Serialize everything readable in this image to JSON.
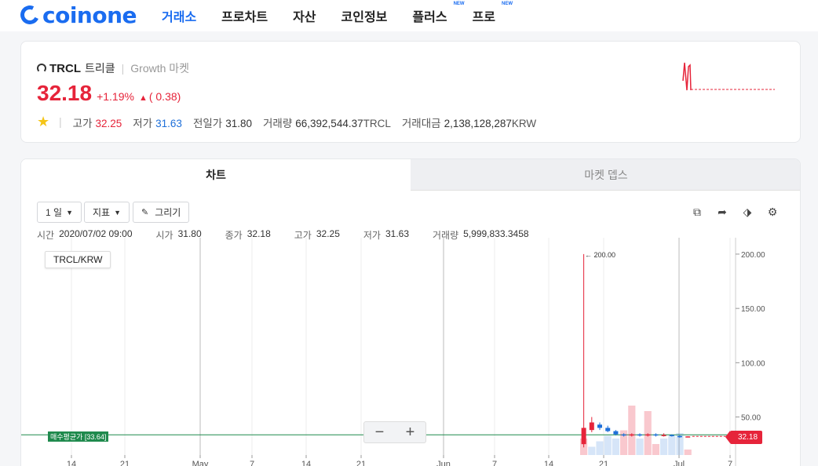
{
  "header": {
    "logo_text": "coinone",
    "nav": [
      {
        "label": "거래소",
        "active": true,
        "badge": ""
      },
      {
        "label": "프로차트",
        "active": false,
        "badge": ""
      },
      {
        "label": "자산",
        "active": false,
        "badge": ""
      },
      {
        "label": "코인정보",
        "active": false,
        "badge": ""
      },
      {
        "label": "플러스",
        "active": false,
        "badge": "NEW"
      },
      {
        "label": "프로",
        "active": false,
        "badge": "NEW"
      }
    ]
  },
  "summary": {
    "symbol": "TRCL",
    "name_kr": "트리클",
    "market": "Growth 마켓",
    "price": "32.18",
    "change_pct": "+1.19%",
    "change_abs": "( 0.38)",
    "change_arrow": "▲",
    "stats": {
      "high_label": "고가",
      "high": "32.25",
      "low_label": "저가",
      "low": "31.63",
      "prev_label": "전일가",
      "prev": "31.80",
      "vol_label": "거래량",
      "vol": "66,392,544.37",
      "vol_unit": "TRCL",
      "amt_label": "거래대금",
      "amt": "2,138,128,287",
      "amt_unit": "KRW"
    }
  },
  "chart_panel": {
    "tab_chart": "차트",
    "tab_depth": "마켓 뎁스",
    "interval_label": "1 일",
    "indicator_label": "지표",
    "draw_label": "그리기",
    "ohlc": {
      "time_label": "시간",
      "time": "2020/07/02 09:00",
      "open_label": "시가",
      "open": "31.80",
      "close_label": "종가",
      "close": "32.18",
      "high_label": "고가",
      "high": "32.25",
      "low_label": "저가",
      "low": "31.63",
      "vol_label": "거래량",
      "vol": "5,999,833.3458"
    },
    "pair_label": "TRCL/KRW",
    "avg_label": "매수평균가 [33.64]",
    "price_tag": "32.18",
    "max_marker": "← 200.00",
    "zoom_minus": "−",
    "zoom_plus": "+"
  },
  "chart_data": {
    "type": "candlestick",
    "y_ticks": [
      "200.00",
      "150.00",
      "100.00",
      "50.00"
    ],
    "ylim": [
      15,
      205
    ],
    "x_tick_labels": [
      "14",
      "21",
      "May",
      "7",
      "14",
      "21",
      "Jun",
      "7",
      "14",
      "21",
      "Jul",
      "7"
    ],
    "avg_buy_price": 33.64,
    "last_price": 32.18,
    "candles": [
      {
        "open": 25,
        "close": 40,
        "high": 200,
        "low": 22,
        "up": true
      },
      {
        "open": 38,
        "close": 45,
        "high": 50,
        "low": 36,
        "up": true
      },
      {
        "open": 43,
        "close": 40,
        "high": 45,
        "low": 38,
        "up": false
      },
      {
        "open": 40,
        "close": 37,
        "high": 42,
        "low": 36,
        "up": false
      },
      {
        "open": 37,
        "close": 34,
        "high": 38,
        "low": 33,
        "up": false
      },
      {
        "open": 34,
        "close": 33,
        "high": 35,
        "low": 32,
        "up": false
      },
      {
        "open": 33,
        "close": 34,
        "high": 35,
        "low": 32,
        "up": true
      },
      {
        "open": 34,
        "close": 33,
        "high": 35,
        "low": 32,
        "up": false
      },
      {
        "open": 33,
        "close": 34,
        "high": 35,
        "low": 32,
        "up": true
      },
      {
        "open": 34,
        "close": 33,
        "high": 35,
        "low": 32,
        "up": false
      },
      {
        "open": 33,
        "close": 33.5,
        "high": 35,
        "low": 32,
        "up": true
      },
      {
        "open": 33.5,
        "close": 32.5,
        "high": 34,
        "low": 32,
        "up": false
      },
      {
        "open": 32.5,
        "close": 32,
        "high": 33,
        "low": 31,
        "up": false
      },
      {
        "open": 31.8,
        "close": 32.18,
        "high": 32.25,
        "low": 31.63,
        "up": true
      }
    ],
    "volumes": [
      {
        "value": 0.3,
        "up": true
      },
      {
        "value": 0.15,
        "up": false
      },
      {
        "value": 0.25,
        "up": false
      },
      {
        "value": 0.35,
        "up": false
      },
      {
        "value": 0.3,
        "up": false
      },
      {
        "value": 0.45,
        "up": true
      },
      {
        "value": 0.9,
        "up": true
      },
      {
        "value": 0.3,
        "up": false
      },
      {
        "value": 0.8,
        "up": true
      },
      {
        "value": 0.2,
        "up": true
      },
      {
        "value": 0.3,
        "up": false
      },
      {
        "value": 0.35,
        "up": false
      },
      {
        "value": 0.4,
        "up": false
      },
      {
        "value": 0.1,
        "up": true
      }
    ]
  },
  "colors": {
    "up": "#e6243a",
    "down": "#1e6fd9",
    "accent": "#1a6cf0",
    "avg_line": "#1f8a4d"
  }
}
